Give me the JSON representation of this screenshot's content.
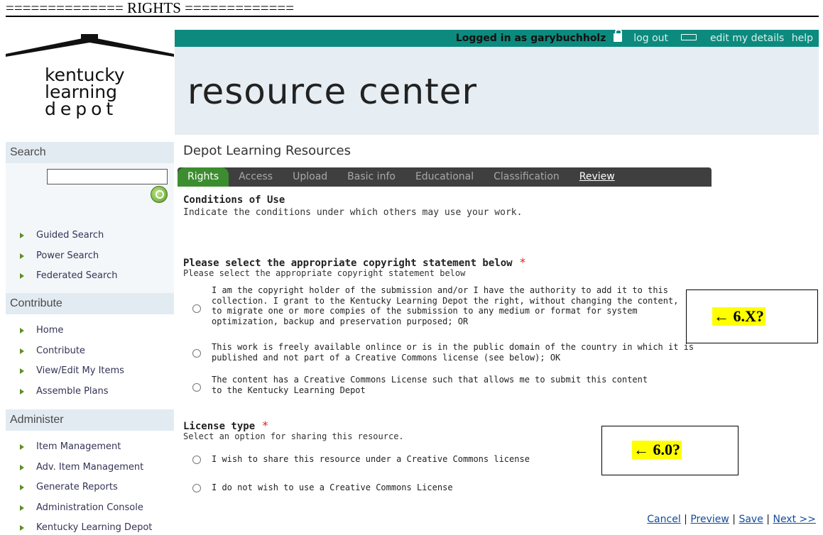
{
  "doc_heading": "============== RIGHTS =============",
  "top_bar": {
    "logged_in": "Logged in as garybuchholz",
    "log_out": "log out",
    "edit_details": "edit my details",
    "help": "help"
  },
  "logo": {
    "line1": "kentucky",
    "line2": "learning",
    "line3": "depot"
  },
  "banner_title": "resource center",
  "page_subtitle": "Depot Learning Resources",
  "sidebar": {
    "search": {
      "title": "Search",
      "input_value": "",
      "items": [
        "Guided Search",
        "Power Search",
        "Federated Search"
      ]
    },
    "contribute": {
      "title": "Contribute",
      "items": [
        "Home",
        "Contribute",
        "View/Edit My Items",
        "Assemble Plans"
      ]
    },
    "administer": {
      "title": "Administer",
      "items": [
        "Item Management",
        "Adv. Item Management",
        "Generate Reports",
        "Administration Console",
        "Kentucky Learning Depot"
      ]
    }
  },
  "tabs": [
    "Rights",
    "Access",
    "Upload",
    "Basic info",
    "Educational",
    "Classification",
    "Review"
  ],
  "active_tab": "Rights",
  "conditions": {
    "title": "Conditions of Use",
    "description": "Indicate the conditions under which others may use your work."
  },
  "copyright": {
    "title": "Please select the appropriate copyright statement below",
    "required_mark": "*",
    "subtitle": "Please select the appropriate copyright statement below",
    "options": [
      {
        "lines": [
          "I am the copyright holder of the submission and/or I have the authority to add it to this",
          "collection. I grant to the Kentucky Learning Depot the right, without changing the content,",
          "to migrate one or more compies of the submission to any medium or format for system",
          "optimization, backup and preservation purposed; OR"
        ]
      },
      {
        "lines": [
          "This work is freely available onlince or is in the public domain of the country in which it is",
          "published and not part of a Creative Commons license (see below); OK"
        ]
      },
      {
        "lines": [
          "The content has a Creative Commons License such that allows me to submit this content",
          "to the Kentucky Learning Depot"
        ]
      }
    ]
  },
  "license": {
    "title": "License type",
    "required_mark": "*",
    "subtitle": "Select an option for sharing this resource.",
    "options": [
      "I wish to share this resource under a Creative Commons license",
      "I do not wish to use a Creative Commons License"
    ]
  },
  "annotations": {
    "copyright_note": "← 6.X?",
    "license_note": "← 6.0?"
  },
  "bottom_links": {
    "cancel": "Cancel",
    "preview": "Preview",
    "save": "Save",
    "next": "Next >>",
    "separator": "|"
  }
}
